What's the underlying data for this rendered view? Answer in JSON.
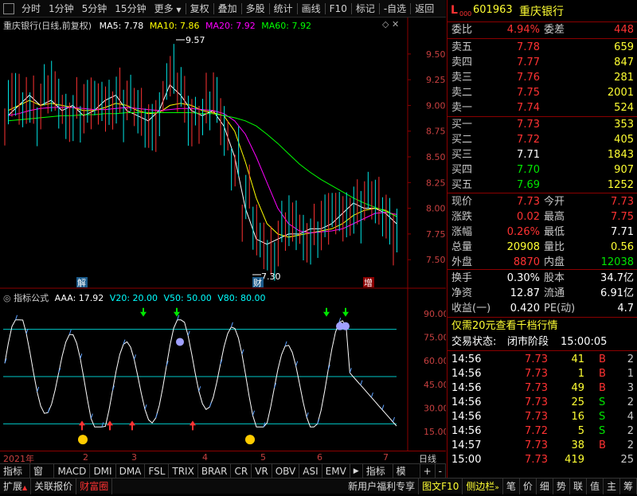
{
  "toolbar": {
    "items": [
      "分时",
      "1分钟",
      "5分钟",
      "15分钟",
      "更多",
      "复权",
      "叠加",
      "多股",
      "统计",
      "画线",
      "F10",
      "标记",
      "-自选",
      "返回"
    ]
  },
  "kline": {
    "title": "重庆银行(日线,前复权)",
    "ma5_label": "MA5: 7.78",
    "ma10_label": "MA10: 7.86",
    "ma20_label": "MA20: 7.92",
    "ma60_label": "MA60: 7.92",
    "high_mark": "9.57",
    "low_mark": "7.30",
    "markers": [
      "解",
      "财",
      "增"
    ],
    "y_ticks": [
      "9.50",
      "9.25",
      "9.00",
      "8.75",
      "8.50",
      "8.25",
      "8.00",
      "7.75",
      "7.50"
    ],
    "colors": {
      "ma5": "#ffffff",
      "ma10": "#ffff00",
      "ma20": "#ff00ff",
      "ma60": "#00ff00"
    }
  },
  "indicator": {
    "title": "指标公式",
    "aaa": "AAA: 17.92",
    "v20": "V20: 20.00",
    "v50": "V50: 50.00",
    "v80": "V80: 80.00",
    "y_ticks": [
      "90.00",
      "75.00",
      "60.00",
      "45.00",
      "30.00",
      "15.00"
    ]
  },
  "chart_data": {
    "type": "line",
    "title": "重庆银行(日线,前复权)",
    "ylim": [
      7.3,
      9.7
    ],
    "series": [
      {
        "name": "MA5",
        "values": [
          8.9,
          9.0,
          9.1,
          9.0,
          9.05,
          8.95,
          9.0,
          8.9,
          8.95,
          9.05,
          9.1,
          8.95,
          8.9,
          8.85,
          8.95,
          9.2,
          9.1,
          8.95,
          8.9,
          8.95,
          8.8,
          8.5,
          8.0,
          7.7,
          7.65,
          7.7,
          7.75,
          7.75,
          7.8,
          7.8,
          7.85,
          7.95,
          8.05,
          8.0,
          8.0,
          7.95,
          7.85
        ]
      },
      {
        "name": "MA10",
        "values": [
          8.95,
          9.0,
          9.05,
          9.0,
          9.02,
          9.0,
          8.98,
          8.95,
          8.95,
          8.98,
          9.02,
          9.0,
          8.95,
          8.92,
          8.93,
          9.0,
          9.02,
          9.0,
          8.95,
          8.93,
          8.9,
          8.75,
          8.45,
          8.1,
          7.85,
          7.75,
          7.72,
          7.74,
          7.76,
          7.78,
          7.8,
          7.85,
          7.93,
          7.98,
          8.0,
          7.98,
          7.92
        ]
      },
      {
        "name": "MA20",
        "values": [
          8.9,
          8.92,
          8.95,
          8.97,
          8.98,
          8.98,
          8.98,
          8.97,
          8.96,
          8.96,
          8.97,
          8.98,
          8.97,
          8.96,
          8.95,
          8.96,
          8.97,
          8.97,
          8.96,
          8.95,
          8.92,
          8.85,
          8.72,
          8.5,
          8.25,
          8.0,
          7.85,
          7.78,
          7.76,
          7.77,
          7.78,
          7.8,
          7.85,
          7.9,
          7.95,
          7.96,
          7.94
        ]
      },
      {
        "name": "MA60",
        "values": [
          8.85,
          8.86,
          8.87,
          8.88,
          8.89,
          8.9,
          8.9,
          8.91,
          8.91,
          8.92,
          8.92,
          8.93,
          8.93,
          8.93,
          8.93,
          8.93,
          8.93,
          8.93,
          8.92,
          8.92,
          8.9,
          8.88,
          8.85,
          8.8,
          8.72,
          8.63,
          8.53,
          8.43,
          8.35,
          8.28,
          8.22,
          8.16,
          8.1,
          8.05,
          8.01,
          7.97,
          7.92
        ]
      }
    ],
    "x": [
      "2021年",
      "2",
      "3",
      "4",
      "5",
      "6",
      "7"
    ]
  },
  "quote": {
    "badge": "L",
    "badge_sub": "000",
    "code": "601963",
    "name": "重庆银行",
    "weibi_label": "委比",
    "weibi_value": "4.94%",
    "weicha_label": "委差",
    "weicha_value": "448",
    "asks": [
      {
        "label": "卖五",
        "price": "7.78",
        "vol": "659"
      },
      {
        "label": "卖四",
        "price": "7.77",
        "vol": "847"
      },
      {
        "label": "卖三",
        "price": "7.76",
        "vol": "281"
      },
      {
        "label": "卖二",
        "price": "7.75",
        "vol": "2001"
      },
      {
        "label": "卖一",
        "price": "7.74",
        "vol": "524"
      }
    ],
    "bids": [
      {
        "label": "买一",
        "price": "7.73",
        "vol": "353"
      },
      {
        "label": "买二",
        "price": "7.72",
        "vol": "405"
      },
      {
        "label": "买三",
        "price": "7.71",
        "vol": "1843"
      },
      {
        "label": "买四",
        "price": "7.70",
        "vol": "907"
      },
      {
        "label": "买五",
        "price": "7.69",
        "vol": "1252"
      }
    ],
    "stats": [
      {
        "l1": "现价",
        "v1": "7.73",
        "l2": "今开",
        "v2": "7.73"
      },
      {
        "l1": "涨跌",
        "v1": "0.02",
        "l2": "最高",
        "v2": "7.75"
      },
      {
        "l1": "涨幅",
        "v1": "0.26%",
        "l2": "最低",
        "v2": "7.71"
      },
      {
        "l1": "总量",
        "v1": "20908",
        "l2": "量比",
        "v2": "0.56"
      },
      {
        "l1": "外盘",
        "v1": "8870",
        "l2": "内盘",
        "v2": "12038"
      }
    ],
    "stats2": [
      {
        "l1": "换手",
        "v1": "0.30%",
        "l2": "股本",
        "v2": "34.7亿"
      },
      {
        "l1": "净资",
        "v1": "12.87",
        "l2": "流通",
        "v2": "6.91亿"
      },
      {
        "l1": "收益(一)",
        "v1": "0.420",
        "l2": "PE(动)",
        "v2": "4.7"
      }
    ],
    "promo": "仅需20元查看千档行情",
    "trade_status_label": "交易状态:",
    "trade_status": "闭市阶段",
    "trade_time": "15:00:05",
    "ticks": [
      {
        "time": "14:56",
        "price": "7.73",
        "vol": "41",
        "side": "B",
        "n": "2"
      },
      {
        "time": "14:56",
        "price": "7.73",
        "vol": "1",
        "side": "B",
        "n": "1"
      },
      {
        "time": "14:56",
        "price": "7.73",
        "vol": "49",
        "side": "B",
        "n": "3"
      },
      {
        "time": "14:56",
        "price": "7.73",
        "vol": "25",
        "side": "S",
        "n": "2"
      },
      {
        "time": "14:56",
        "price": "7.73",
        "vol": "16",
        "side": "S",
        "n": "4"
      },
      {
        "time": "14:56",
        "price": "7.72",
        "vol": "5",
        "side": "S",
        "n": "2"
      },
      {
        "time": "14:57",
        "price": "7.73",
        "vol": "38",
        "side": "B",
        "n": "2"
      },
      {
        "time": "15:00",
        "price": "7.73",
        "vol": "419",
        "side": "",
        "n": "25"
      }
    ]
  },
  "bottom_axis": {
    "labels": [
      "2021年",
      "2",
      "3",
      "4",
      "5",
      "6",
      "7"
    ],
    "period": "日线"
  },
  "bar1": {
    "items": [
      "指标A",
      "窗口",
      "MACD",
      "DMI",
      "DMA",
      "FSL",
      "TRIX",
      "BRAR",
      "CR",
      "VR",
      "OBV",
      "ASI",
      "EMV"
    ],
    "right": [
      "指标B",
      "模 板",
      "+",
      "-"
    ]
  },
  "bar2": {
    "items": [
      "扩展",
      "关联报价",
      "财富圈"
    ],
    "news": "新用户福利专享",
    "right": [
      "图文F10",
      "侧边栏"
    ],
    "right_icons": [
      "笔",
      "价",
      "细",
      "势",
      "联",
      "值",
      "主",
      "筹"
    ]
  }
}
